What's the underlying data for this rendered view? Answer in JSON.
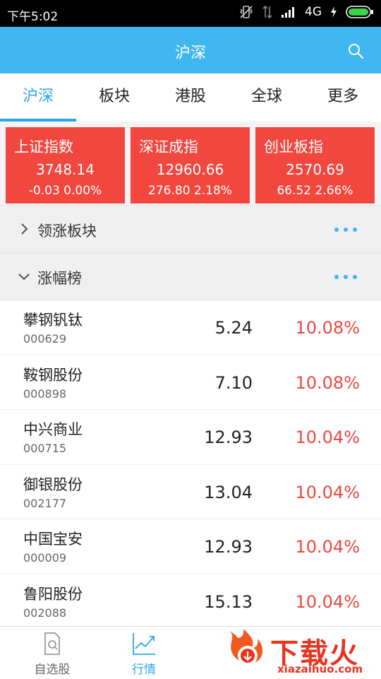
{
  "status_bar": {
    "time": "下午5:02",
    "network": "4G"
  },
  "app_bar": {
    "title": "沪深",
    "search_icon": "search-icon"
  },
  "tabs": [
    {
      "label": "沪深",
      "active": true
    },
    {
      "label": "板块",
      "active": false
    },
    {
      "label": "港股",
      "active": false
    },
    {
      "label": "全球",
      "active": false
    },
    {
      "label": "更多",
      "active": false
    }
  ],
  "indices": [
    {
      "name": "上证指数",
      "value": "3748.14",
      "change": "-0.03 0.00%"
    },
    {
      "name": "深证成指",
      "value": "12960.66",
      "change": "276.80 2.18%"
    },
    {
      "name": "创业板指",
      "value": "2570.69",
      "change": "66.52 2.66%"
    }
  ],
  "sections": {
    "leading_sectors": {
      "label": "领涨板块",
      "expanded": false
    },
    "gainers": {
      "label": "涨幅榜",
      "expanded": true
    }
  },
  "gainers": [
    {
      "name": "攀钢钒钛",
      "code": "000629",
      "price": "5.24",
      "pct": "10.08%"
    },
    {
      "name": "鞍钢股份",
      "code": "000898",
      "price": "7.10",
      "pct": "10.08%"
    },
    {
      "name": "中兴商业",
      "code": "000715",
      "price": "12.93",
      "pct": "10.04%"
    },
    {
      "name": "御银股份",
      "code": "002177",
      "price": "13.04",
      "pct": "10.04%"
    },
    {
      "name": "中国宝安",
      "code": "000009",
      "price": "12.93",
      "pct": "10.04%"
    },
    {
      "name": "鲁阳股份",
      "code": "002088",
      "price": "15.13",
      "pct": "10.04%"
    }
  ],
  "bottom_nav": [
    {
      "label": "自选股",
      "icon": "watchlist-icon",
      "active": false
    },
    {
      "label": "行情",
      "icon": "market-chart-icon",
      "active": true
    }
  ],
  "watermark": {
    "title": "下载火",
    "url": "xiazaihuo.com"
  },
  "colors": {
    "accent": "#40b7ef",
    "up_red": "#f1473f",
    "tab_active": "#2aa6e6"
  }
}
